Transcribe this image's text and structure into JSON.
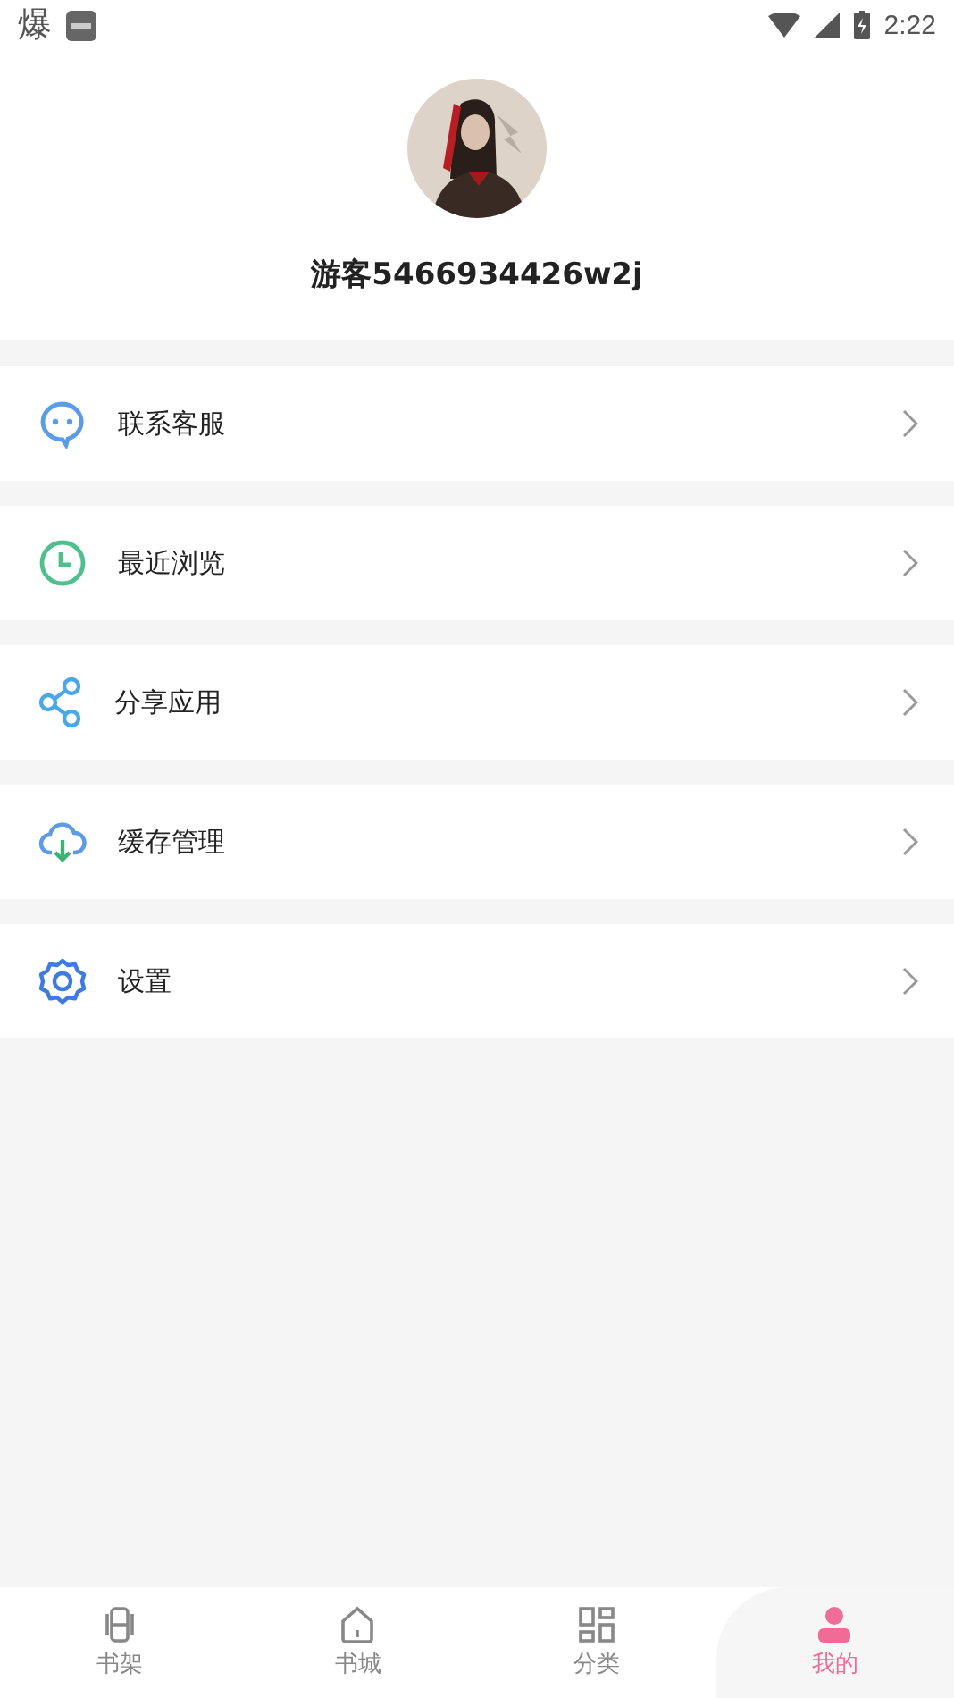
{
  "status_bar": {
    "notification": "爆",
    "time": "2:22"
  },
  "profile": {
    "username": "游客5466934426w2j"
  },
  "menu": [
    {
      "kind": "chat",
      "label": "联系客服"
    },
    {
      "kind": "clock",
      "label": "最近浏览"
    },
    {
      "kind": "share",
      "label": "分享应用"
    },
    {
      "kind": "cloud",
      "label": "缓存管理"
    },
    {
      "kind": "gear",
      "label": "设置"
    }
  ],
  "tabs": [
    {
      "kind": "shelf",
      "label": "书架",
      "selected": false
    },
    {
      "kind": "store",
      "label": "书城",
      "selected": false
    },
    {
      "kind": "category",
      "label": "分类",
      "selected": false
    },
    {
      "kind": "me",
      "label": "我的",
      "selected": true
    }
  ]
}
